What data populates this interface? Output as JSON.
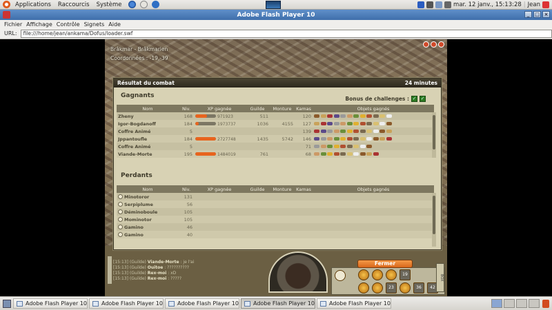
{
  "top_panel": {
    "menus": [
      "Applications",
      "Raccourcis",
      "Système"
    ],
    "clock": "mar. 12 janv., 15:13:28",
    "user": "Jean"
  },
  "window": {
    "title": "Adobe Flash Player 10",
    "menus": [
      "Fichier",
      "Affichage",
      "Contrôle",
      "Signets",
      "Aide"
    ],
    "url_label": "URL:",
    "url_value": "file:///home/jean/ankama/Dofus/loader.swf"
  },
  "game": {
    "map_name": "Brâkmar - Brâkmarien",
    "coords": "Coordonnées : -19,-39"
  },
  "dialog": {
    "title": "Résultat du combat",
    "duration": "24 minutes",
    "winners_title": "Gagnants",
    "losers_title": "Perdants",
    "bonus_label": "Bonus de challenges :",
    "columns": [
      "Nom",
      "Niv.",
      "XP gagnée",
      "Guilde",
      "Monture",
      "Kamas",
      "Objets gagnés"
    ],
    "winners": [
      {
        "name": "Zheny",
        "level": "168",
        "xp_pct": 0.55,
        "xp": "971923",
        "guild": "511",
        "mount": "",
        "kamas": "120",
        "items": 12
      },
      {
        "name": "Igor-Bogdanoff",
        "level": "184",
        "xp_pct": 0.15,
        "xp": "1973737",
        "guild": "1036",
        "mount": "4155",
        "kamas": "127",
        "items": 12
      },
      {
        "name": "Coffre Animé",
        "level": "5",
        "xp_pct": 0,
        "xp": "",
        "guild": "",
        "mount": "",
        "kamas": "139",
        "items": 12
      },
      {
        "name": "Jppantoufle",
        "level": "184",
        "xp_pct": 1.0,
        "xp": "2727748",
        "guild": "1435",
        "mount": "5742",
        "kamas": "146",
        "items": 12
      },
      {
        "name": "Coffre Animé",
        "level": "5",
        "xp_pct": 0,
        "xp": "",
        "guild": "",
        "mount": "",
        "kamas": "71",
        "items": 9
      },
      {
        "name": "Viande-Morte",
        "level": "195",
        "xp_pct": 1.0,
        "xp": "1484019",
        "guild": "761",
        "mount": "",
        "kamas": "68",
        "items": 10
      }
    ],
    "losers": [
      {
        "name": "Minotoror",
        "level": "131"
      },
      {
        "name": "Serpiplume",
        "level": "56"
      },
      {
        "name": "Déminoboule",
        "level": "105"
      },
      {
        "name": "Mominotor",
        "level": "105"
      },
      {
        "name": "Gamino",
        "level": "46"
      },
      {
        "name": "Gamino",
        "level": "40"
      }
    ],
    "close_label": "Fermer"
  },
  "chat": [
    {
      "time": "[15:13]",
      "channel": "(Guilde)",
      "who": "Viande-Morte",
      "msg": ": je l'ai"
    },
    {
      "time": "[15:13]",
      "channel": "(Guilde)",
      "who": "Ouitoe",
      "msg": ": ??????????"
    },
    {
      "time": "[15:13]",
      "channel": "(Guilde)",
      "who": "Rex-moi",
      "msg": ": xD"
    },
    {
      "time": "[15:13]",
      "channel": "(Guilde)",
      "who": "Rex-moi",
      "msg": ": ?????"
    }
  ],
  "spells": {
    "counts": [
      "19",
      "23",
      "36",
      "42"
    ]
  },
  "side_tab_label": "BOX",
  "taskbar": {
    "tasks": [
      "Adobe Flash Player 10",
      "Adobe Flash Player 10",
      "Adobe Flash Player 10",
      "Adobe Flash Player 10",
      "Adobe Flash Player 10"
    ],
    "active_index": 3
  },
  "colors": {
    "accent_orange": "#e8641e",
    "title_blue": "#4f7fbd",
    "dialog_bg": "#d8d2b4"
  }
}
